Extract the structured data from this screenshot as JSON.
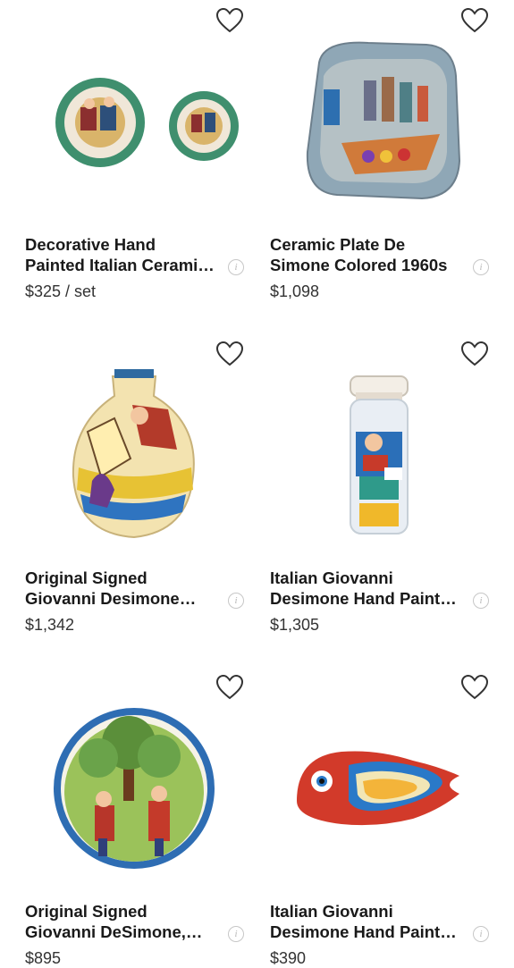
{
  "listings": [
    {
      "title": "Decorative Hand Painted Italian Ceramic Plates",
      "price": "$325 / set",
      "image": "two painted plates with figures",
      "favorite_icon": "heart-outline-icon"
    },
    {
      "title": "Ceramic Plate De Simone Colored 1960s",
      "price": "$1,098",
      "image": "relief ceramic plate with boat and figures",
      "favorite_icon": "heart-outline-icon"
    },
    {
      "title": "Original Signed Giovanni Desimone Vase",
      "price": "$1,342",
      "image": "painted ceramic vase with figure",
      "favorite_icon": "heart-outline-icon"
    },
    {
      "title": "Italian Giovanni Desimone Hand Painted Vase",
      "price": "$1,305",
      "image": "tall painted ceramic vase with figures",
      "favorite_icon": "heart-outline-icon"
    },
    {
      "title": "Original Signed Giovanni DeSimone, Plate",
      "price": "$895",
      "image": "round plate with men harvesting tree",
      "favorite_icon": "heart-outline-icon"
    },
    {
      "title": "Italian Giovanni Desimone Hand Painted Fish Plate",
      "price": "$390",
      "image": "fish shaped ceramic plate",
      "favorite_icon": "heart-outline-icon"
    }
  ],
  "info_icon": "info-icon"
}
